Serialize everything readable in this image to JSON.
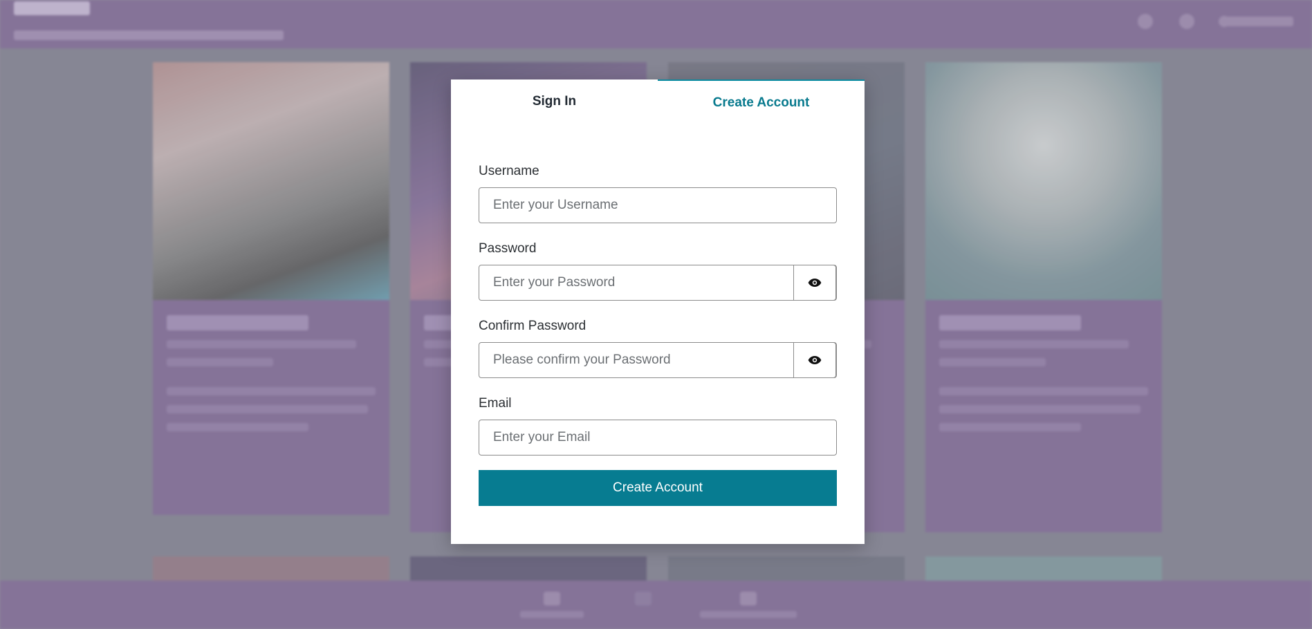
{
  "modal": {
    "tabs": [
      {
        "label": "Sign In",
        "active": false
      },
      {
        "label": "Create Account",
        "active": true
      }
    ],
    "fields": {
      "username": {
        "label": "Username",
        "placeholder": "Enter your Username",
        "value": ""
      },
      "password": {
        "label": "Password",
        "placeholder": "Enter your Password",
        "value": ""
      },
      "confirm_password": {
        "label": "Confirm Password",
        "placeholder": "Please confirm your Password",
        "value": ""
      },
      "email": {
        "label": "Email",
        "placeholder": "Enter your Email",
        "value": ""
      }
    },
    "submit_label": "Create Account",
    "icons": {
      "password_toggle": "eye-icon",
      "confirm_toggle": "eye-icon"
    }
  },
  "colors": {
    "accent": "#077c91",
    "active_tab_text": "#087a8e",
    "overlay_bar": "#8b789e",
    "card_background": "#8b789e"
  }
}
